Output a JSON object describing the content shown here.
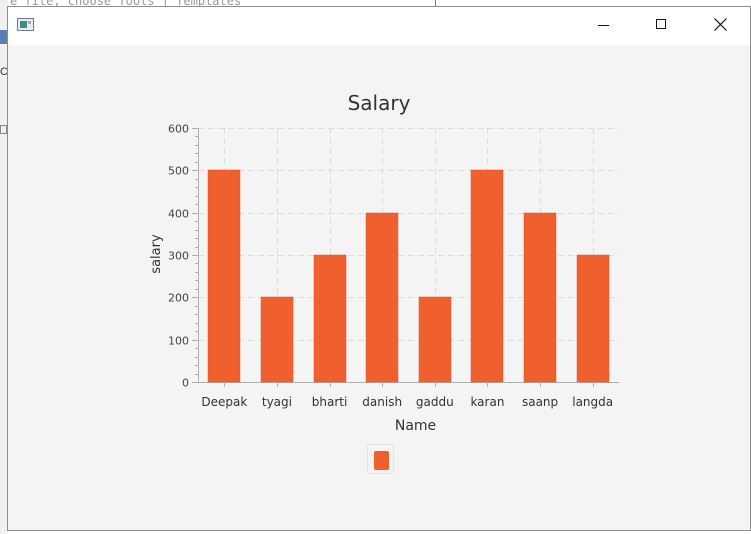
{
  "background": {
    "editor_text": "e file, choose Tools | Templates",
    "left_fragment": "Ca"
  },
  "window": {
    "app_icon": "java-app-icon",
    "controls": {
      "minimize": "minimize-icon",
      "maximize": "maximize-icon",
      "close": "close-icon"
    }
  },
  "colors": {
    "bar": "#f0602e",
    "grid": "#dcdcdc",
    "axis": "#b0b0b0",
    "window_bg": "#f4f4f4"
  },
  "chart_data": {
    "type": "bar",
    "title": "Salary",
    "xlabel": "Name",
    "ylabel": "salary",
    "categories": [
      "Deepak",
      "tyagi",
      "bharti",
      "danish",
      "gaddu",
      "karan",
      "saanp",
      "langda"
    ],
    "series": [
      {
        "values": [
          500,
          200,
          300,
          400,
          200,
          500,
          400,
          300
        ]
      }
    ],
    "ylim": [
      0,
      600
    ],
    "yticks": [
      "0",
      "100",
      "200",
      "300",
      "400",
      "500",
      "600"
    ],
    "grid": true,
    "legend": "bottom"
  }
}
